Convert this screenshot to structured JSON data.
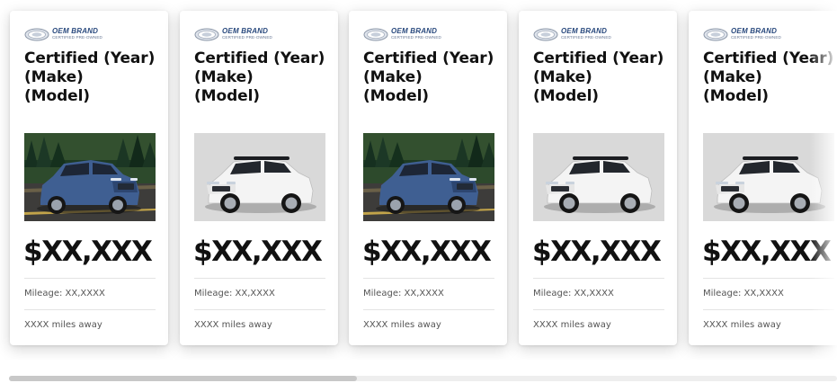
{
  "brand": {
    "name": "OEM BRAND",
    "subtitle": "CERTIFIED PRE-OWNED",
    "logo_icon": "oval-brand-logo-icon",
    "color": "#2a4a7e"
  },
  "cards": [
    {
      "title": "Certified (Year)\n(Make)\n(Model)",
      "image": "blue-suv-forest-photo",
      "price": "$XX,XXX",
      "mileage": "Mileage: XX,XXXX",
      "distance": "XXXX miles away"
    },
    {
      "title": "Certified (Year)\n(Make)\n(Model)",
      "image": "white-suv-studio-photo",
      "price": "$XX,XXX",
      "mileage": "Mileage: XX,XXXX",
      "distance": "XXXX miles away"
    },
    {
      "title": "Certified (Year)\n(Make)\n(Model)",
      "image": "blue-suv-forest-photo",
      "price": "$XX,XXX",
      "mileage": "Mileage: XX,XXXX",
      "distance": "XXXX miles away"
    },
    {
      "title": "Certified (Year)\n(Make)\n(Model)",
      "image": "white-suv-studio-photo",
      "price": "$XX,XXX",
      "mileage": "Mileage: XX,XXXX",
      "distance": "XXXX miles away"
    },
    {
      "title": "Certified (Year)\n(Make)\n(Model)",
      "image": "white-suv-studio-photo",
      "price": "$XX,XXX",
      "mileage": "Mileage: XX,XXXX",
      "distance": "XXXX miles away"
    }
  ],
  "scrollbar": {
    "progress": 0.42
  }
}
